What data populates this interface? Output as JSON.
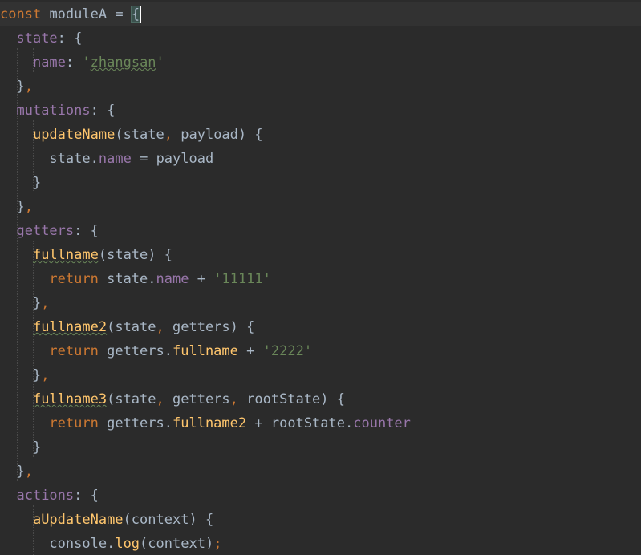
{
  "editor": {
    "language": "javascript",
    "theme": "darcula",
    "colors": {
      "background": "#2b2b2b",
      "current_line": "#323232",
      "keyword": "#cc7832",
      "property": "#9876aa",
      "function": "#ffc66d",
      "string": "#6a8759",
      "plain": "#a9b7c6"
    },
    "lines": [
      "const moduleA = {",
      "  state: {",
      "    name: 'zhangsan'",
      "  },",
      "  mutations: {",
      "    updateName(state, payload) {",
      "      state.name = payload",
      "    }",
      "  },",
      "  getters: {",
      "    fullname(state) {",
      "      return state.name + '11111'",
      "    },",
      "    fullname2(state, getters) {",
      "      return getters.fullname + '2222'",
      "    },",
      "    fullname3(state, getters, rootState) {",
      "      return getters.fullname2 + rootState.counter",
      "    }",
      "  },",
      "  actions: {",
      "    aUpdateName(context) {",
      "      console.log(context);"
    ],
    "tokens": {
      "kw_const": "const",
      "kw_return": "return",
      "module_name": "moduleA",
      "eq": "=",
      "plus": "+",
      "open_brace": "{",
      "close_brace": "}",
      "close_brace_comma": "},",
      "comma": ",",
      "colon": ":",
      "dot": ".",
      "semicolon": ";",
      "lparen": "(",
      "rparen": ")",
      "state": "state",
      "name": "name",
      "zhangsan": "zhangsan",
      "quote": "'",
      "mutations": "mutations",
      "updateName": "updateName",
      "payload": "payload",
      "getters": "getters",
      "fullname": "fullname",
      "fullname2": "fullname2",
      "fullname3": "fullname3",
      "s11111": "11111",
      "s2222": "2222",
      "rootState": "rootState",
      "counter": "counter",
      "actions": "actions",
      "aUpdateName": "aUpdateName",
      "context": "context",
      "console": "console",
      "log": "log"
    }
  }
}
